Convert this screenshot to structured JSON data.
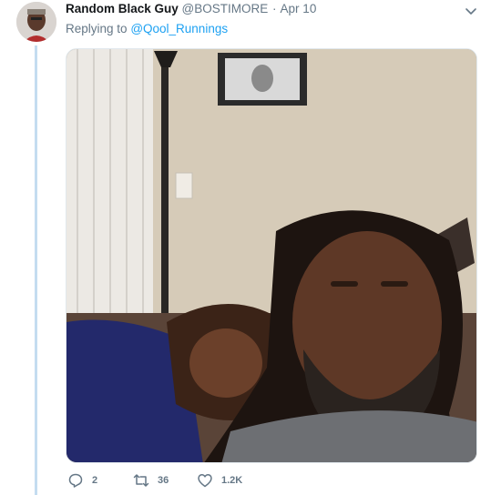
{
  "tweet": {
    "author_name": "Random Black Guy",
    "author_handle": "@BOSTIMORE",
    "separator": "·",
    "date": "Apr 10",
    "replying_prefix": "Replying to",
    "replying_to": "@Qool_Runnings",
    "media_icon": "photo",
    "actions": {
      "reply_count": "2",
      "retweet_count": "36",
      "like_count": "1.2K"
    }
  },
  "colors": {
    "accent": "#1da1f2",
    "muted": "#657786",
    "thread_line": "#c4dcf0"
  },
  "icons": [
    "chevron-down-icon",
    "reply-icon",
    "retweet-icon",
    "heart-icon"
  ]
}
